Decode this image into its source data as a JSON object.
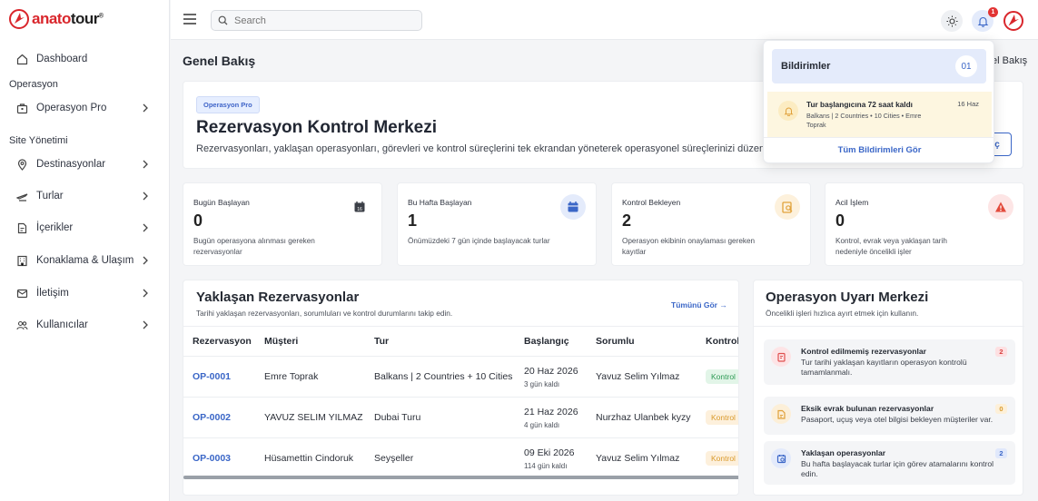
{
  "brand": {
    "name_a": "anato",
    "name_b": "tour",
    "mark": "®"
  },
  "sidebar": {
    "dashboard": "Dashboard",
    "section_ops": "Operasyon",
    "ops_pro": "Operasyon Pro",
    "section_site": "Site Yönetimi",
    "items": [
      {
        "label": "Destinasyonlar",
        "icon": "map-pin-icon"
      },
      {
        "label": "Turlar",
        "icon": "plane-icon"
      },
      {
        "label": "İçerikler",
        "icon": "document-icon"
      },
      {
        "label": "Konaklama & Ulaşım",
        "icon": "building-icon"
      },
      {
        "label": "İletişim",
        "icon": "mail-icon"
      },
      {
        "label": "Kullanıcılar",
        "icon": "users-icon"
      }
    ]
  },
  "search": {
    "placeholder": "Search"
  },
  "notifications_count": "1",
  "page": {
    "title": "Genel Bakış",
    "breadcrumb": "el Bakış"
  },
  "hero": {
    "pill": "Operasyon Pro",
    "title": "Rezervasyon Kontrol Merkezi",
    "desc": "Rezervasyonları, yaklaşan operasyonları, görevleri ve kontrol süreçlerini tek ekrandan yöneterek operasyonel süreçlerinizi düzenli şekilde",
    "button": "ç"
  },
  "stats": [
    {
      "title": "Bugün Başlayan",
      "value": "0",
      "desc": "Bugün operasyona alınması gereken rezervasyonlar",
      "icon": "calendar-icon",
      "bg": "#ffffff",
      "fg": "#3b3f47"
    },
    {
      "title": "Bu Hafta Başlayan",
      "value": "1",
      "desc": "Önümüzdeki 7 gün içinde başlayacak turlar",
      "icon": "calendar-week-icon",
      "bg": "#e4ebfb",
      "fg": "#3a66c7"
    },
    {
      "title": "Kontrol Bekleyen",
      "value": "2",
      "desc": "Operasyon ekibinin onaylaması gereken kayıtlar",
      "icon": "clipboard-search-icon",
      "bg": "#fdf1dc",
      "fg": "#e1a23b"
    },
    {
      "title": "Acil İşlem",
      "value": "0",
      "desc": "Kontrol, evrak veya yaklaşan tarih nedeniyle öncelikli işler",
      "icon": "warning-icon",
      "bg": "#fde5e5",
      "fg": "#e34a3c"
    }
  ],
  "upcoming": {
    "title": "Yaklaşan Rezervasyonlar",
    "subtitle": "Tarihi yaklaşan rezervasyonları, sorumluları ve kontrol durumlarını takip edin.",
    "see_all": "Tümünü Gör →",
    "columns": [
      "Rezervasyon",
      "Müşteri",
      "Tur",
      "Başlangıç",
      "Sorumlu",
      "Kontrol"
    ],
    "rows": [
      {
        "id": "OP-0001",
        "customer": "Emre Toprak",
        "tour": "Balkans | 2 Countries + 10 Cities",
        "date": "20 Haz 2026",
        "days": "3 gün kaldı",
        "owner": "Yavuz Selim Yılmaz",
        "status": "Kontrol",
        "status_bg": "#e2f5e8",
        "status_fg": "#2e9a55"
      },
      {
        "id": "OP-0002",
        "customer": "YAVUZ SELIM YILMAZ",
        "tour": "Dubai Turu",
        "date": "21 Haz 2026",
        "days": "4 gün kaldı",
        "owner": "Nurzhaz Ulanbek kyzy",
        "status": "Kontrol",
        "status_bg": "#fdf0dc",
        "status_fg": "#d99a2b"
      },
      {
        "id": "OP-0003",
        "customer": "Hüsamettin Cindoruk",
        "tour": "Seyşeller",
        "date": "09 Eki 2026",
        "days": "114 gün kaldı",
        "owner": "Yavuz Selim Yılmaz",
        "status": "Kontrol",
        "status_bg": "#fdf0dc",
        "status_fg": "#d99a2b"
      }
    ]
  },
  "alerts": {
    "title": "Operasyon Uyarı Merkezi",
    "subtitle": "Öncelikli işleri hızlıca ayırt etmek için kullanın.",
    "items": [
      {
        "title": "Kontrol edilmemiş rezervasyonlar",
        "desc": "Tur tarihi yaklaşan kayıtların operasyon kontrolü tamamlanmalı.",
        "count": "2",
        "icon": "clipboard-icon",
        "bg": "#fde4e6",
        "fg": "#e0504f",
        "cnt_bg": "#fde0e2",
        "cnt_fg": "#d9413f"
      },
      {
        "title": "Eksik evrak bulunan rezervasyonlar",
        "desc": "Pasaport, uçuş veya otel bilgisi bekleyen müşteriler var.",
        "count": "0",
        "icon": "file-icon",
        "bg": "#fcefd8",
        "fg": "#e0a03a",
        "cnt_bg": "#fdf0d9",
        "cnt_fg": "#d99a2b"
      },
      {
        "title": "Yaklaşan operasyonlar",
        "desc": "Bu hafta başlayacak turlar için görev atamalarını kontrol edin.",
        "count": "2",
        "icon": "calendar-clock-icon",
        "bg": "#e3eafb",
        "fg": "#3a66c7",
        "cnt_bg": "#e0e8fb",
        "cnt_fg": "#3a66c7"
      }
    ]
  },
  "notif": {
    "title": "Bildirimler",
    "count": "01",
    "item_title": "Tur başlangıcına 72 saat kaldı",
    "item_desc": "Balkans | 2 Countries • 10 Cities • Emre Toprak",
    "item_date": "16 Haz",
    "see_all": "Tüm Bildirimleri Gör"
  }
}
